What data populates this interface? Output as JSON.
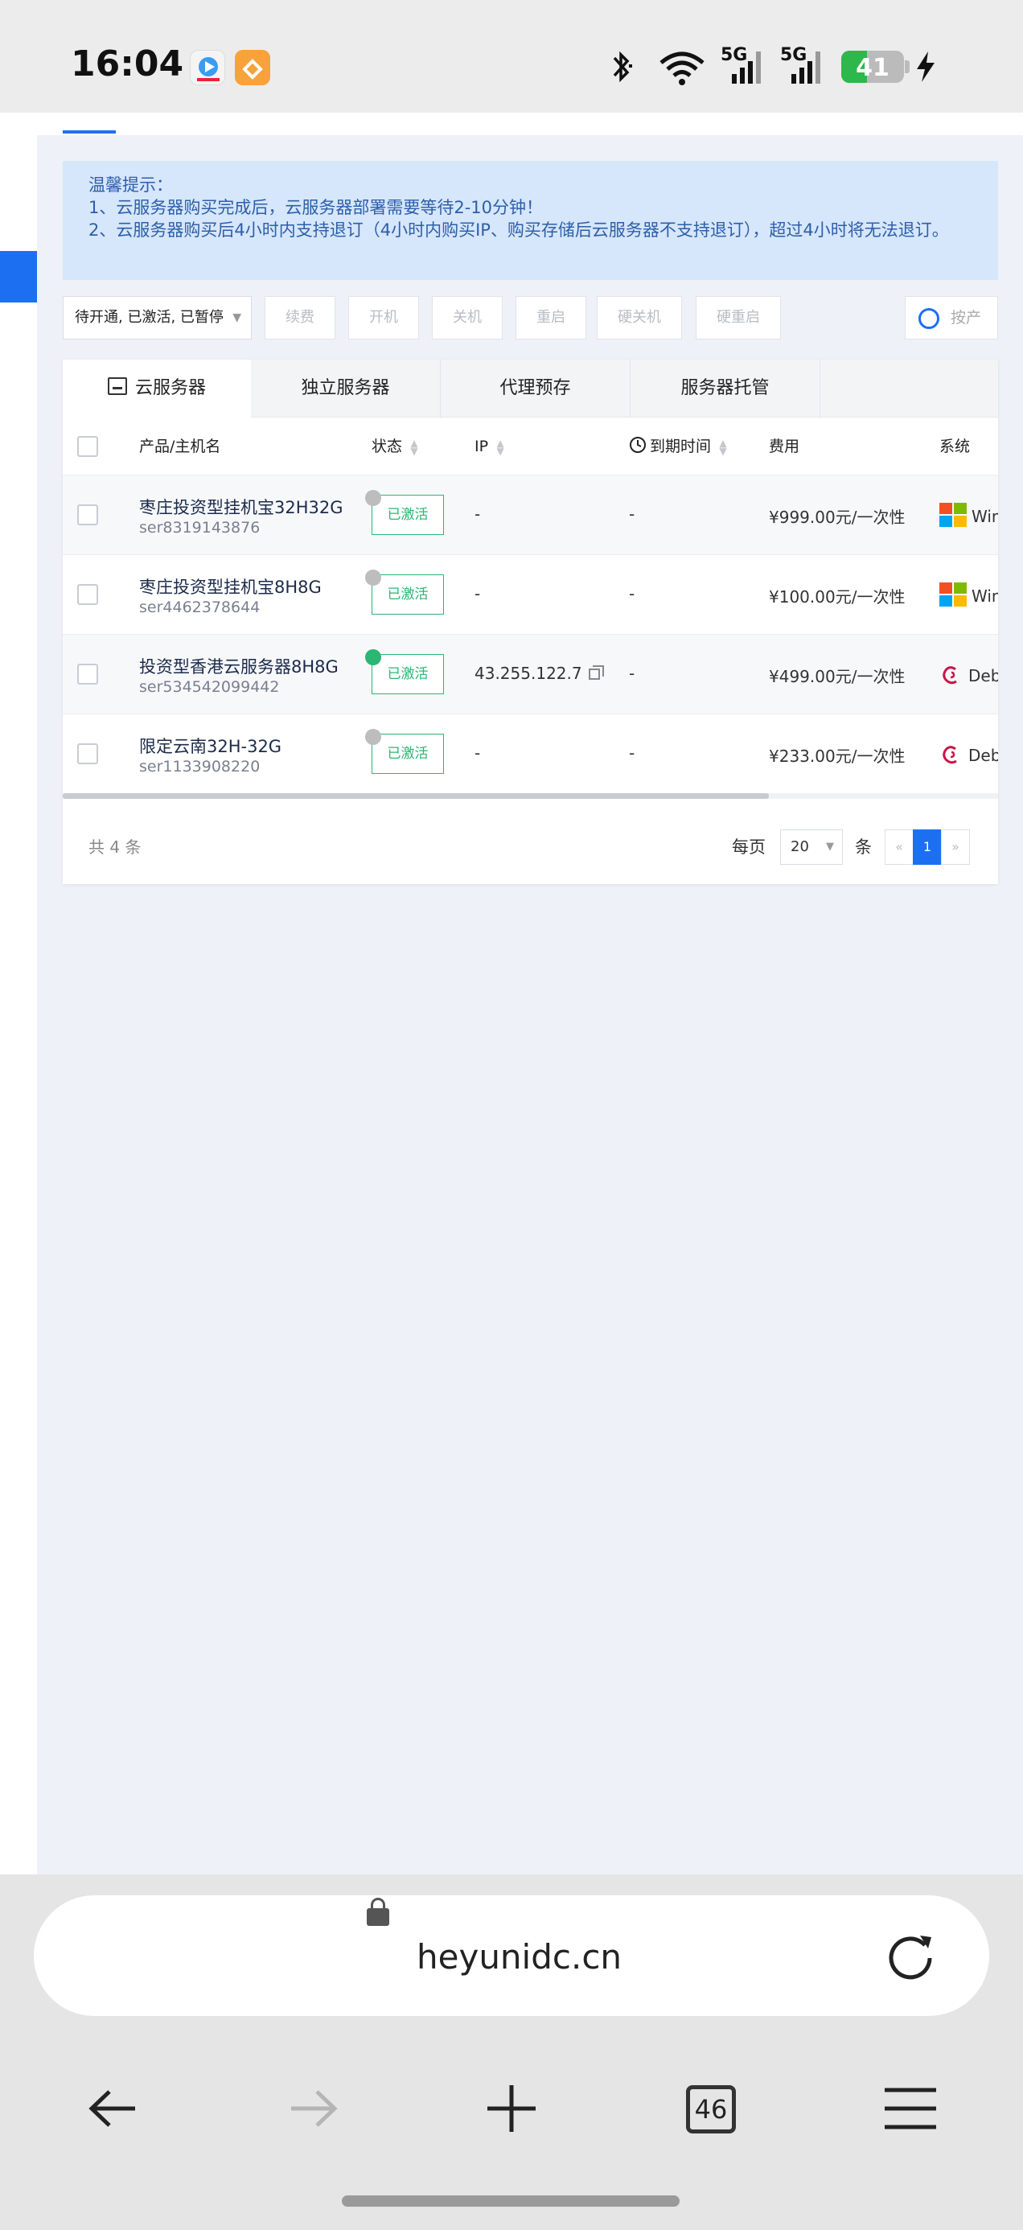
{
  "status_bar": {
    "time": "16:04",
    "battery": "41",
    "battery_level_percent": 41,
    "signal_1": "5G",
    "signal_2": "5G",
    "icons": [
      "video-app-icon",
      "orange-app-icon",
      "bluetooth-icon",
      "wifi-icon",
      "signal-icon",
      "signal-icon",
      "battery-icon",
      "charging-icon"
    ]
  },
  "notice": {
    "title": "温馨提示：",
    "line1": "1、云服务器购买完成后，云服务器部署需要等待2-10分钟！",
    "line2": "2、云服务器购买后4小时内支持退订（4小时内购买IP、购买存储后云服务器不支持退订），超过4小时将无法退订。"
  },
  "toolbar": {
    "filter_value": "待开通, 已激活, 已暂停",
    "buttons": [
      "续费",
      "开机",
      "关机",
      "重启",
      "硬关机",
      "硬重启"
    ],
    "search_placeholder": "按产"
  },
  "tabs": [
    "云服务器",
    "独立服务器",
    "代理预存",
    "服务器托管"
  ],
  "table": {
    "headers": {
      "product": "产品/主机名",
      "status": "状态",
      "ip": "IP",
      "expire": "到期时间",
      "fee": "费用",
      "os": "系统"
    },
    "rows": [
      {
        "name": "枣庄投资型挂机宝32H32G",
        "id": "ser8319143876",
        "status": "已激活",
        "online": false,
        "ip": "-",
        "expire": "-",
        "fee": "¥999.00元/一次性",
        "os": "Win",
        "os_icon": "windows-icon"
      },
      {
        "name": "枣庄投资型挂机宝8H8G",
        "id": "ser4462378644",
        "status": "已激活",
        "online": false,
        "ip": "-",
        "expire": "-",
        "fee": "¥100.00元/一次性",
        "os": "Win",
        "os_icon": "windows-icon"
      },
      {
        "name": "投资型香港云服务器8H8G",
        "id": "ser534542099442",
        "status": "已激活",
        "online": true,
        "ip": "43.255.122.7",
        "expire": "-",
        "fee": "¥499.00元/一次性",
        "os": "Deb",
        "os_icon": "debian-icon"
      },
      {
        "name": "限定云南32H-32G",
        "id": "ser1133908220",
        "status": "已激活",
        "online": false,
        "ip": "-",
        "expire": "-",
        "fee": "¥233.00元/一次性",
        "os": "Deb",
        "os_icon": "debian-icon"
      }
    ]
  },
  "pagination": {
    "total": "共 4 条",
    "per_page_label": "每页",
    "per_page": "20",
    "unit": "条",
    "prev": "«",
    "current": "1",
    "next": "»"
  },
  "browser": {
    "url": "heyunidc.cn",
    "tabs_count": "46"
  },
  "colors": {
    "accent": "#1d6ff2",
    "active_green": "#2bb673",
    "notice_bg": "#d6e6fb"
  }
}
